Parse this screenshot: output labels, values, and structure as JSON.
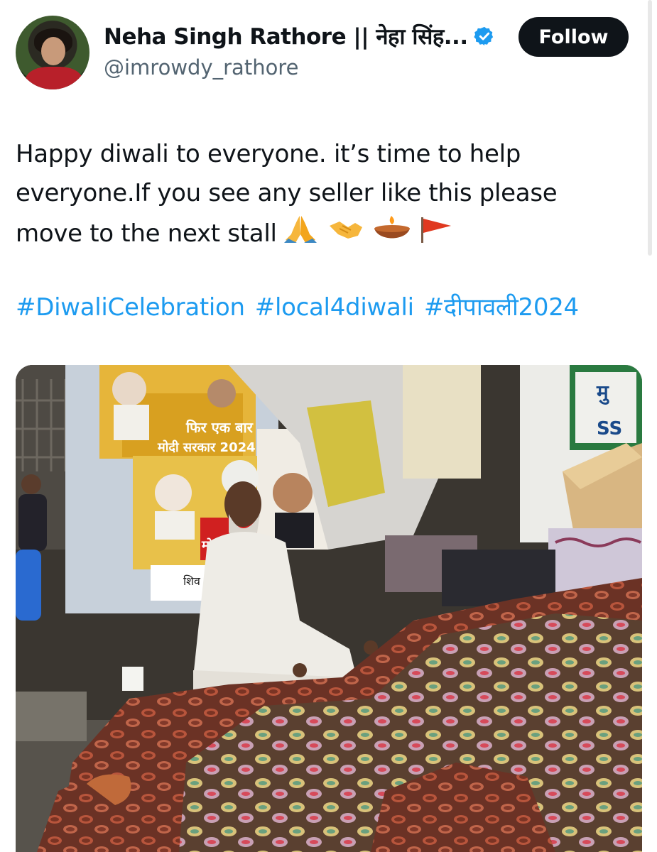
{
  "user": {
    "display_name": "Neha Singh Rathore || नेहा सिंह...",
    "handle": "@imrowdy_rathore",
    "verified": true,
    "avatar_icon": "profile-photo"
  },
  "follow_button": {
    "label": "Follow"
  },
  "tweet": {
    "lines": [
      "Happy diwali to everyone. it’s time to help",
      "everyone.If you see any seller like this please",
      "move to the next stall"
    ],
    "emojis": [
      "folded-hands-icon",
      "handshake-icon",
      "diya-lamp-icon",
      "red-flag-icon"
    ],
    "hashtags": [
      "#DiwaliCelebration",
      "#local4diwali",
      "#दीपावली2024"
    ]
  },
  "media": {
    "poster_text_1": "फिर एक बार",
    "poster_text_2": "मोदी सरकार 2024",
    "poster_text_3": "शिव",
    "sack_text": "मु",
    "sack_text_2": "SS"
  },
  "colors": {
    "link": "#1d9bf0",
    "text": "#0f1419",
    "secondary": "#536471",
    "verified": "#1d9bf0",
    "button": "#0f1419"
  }
}
